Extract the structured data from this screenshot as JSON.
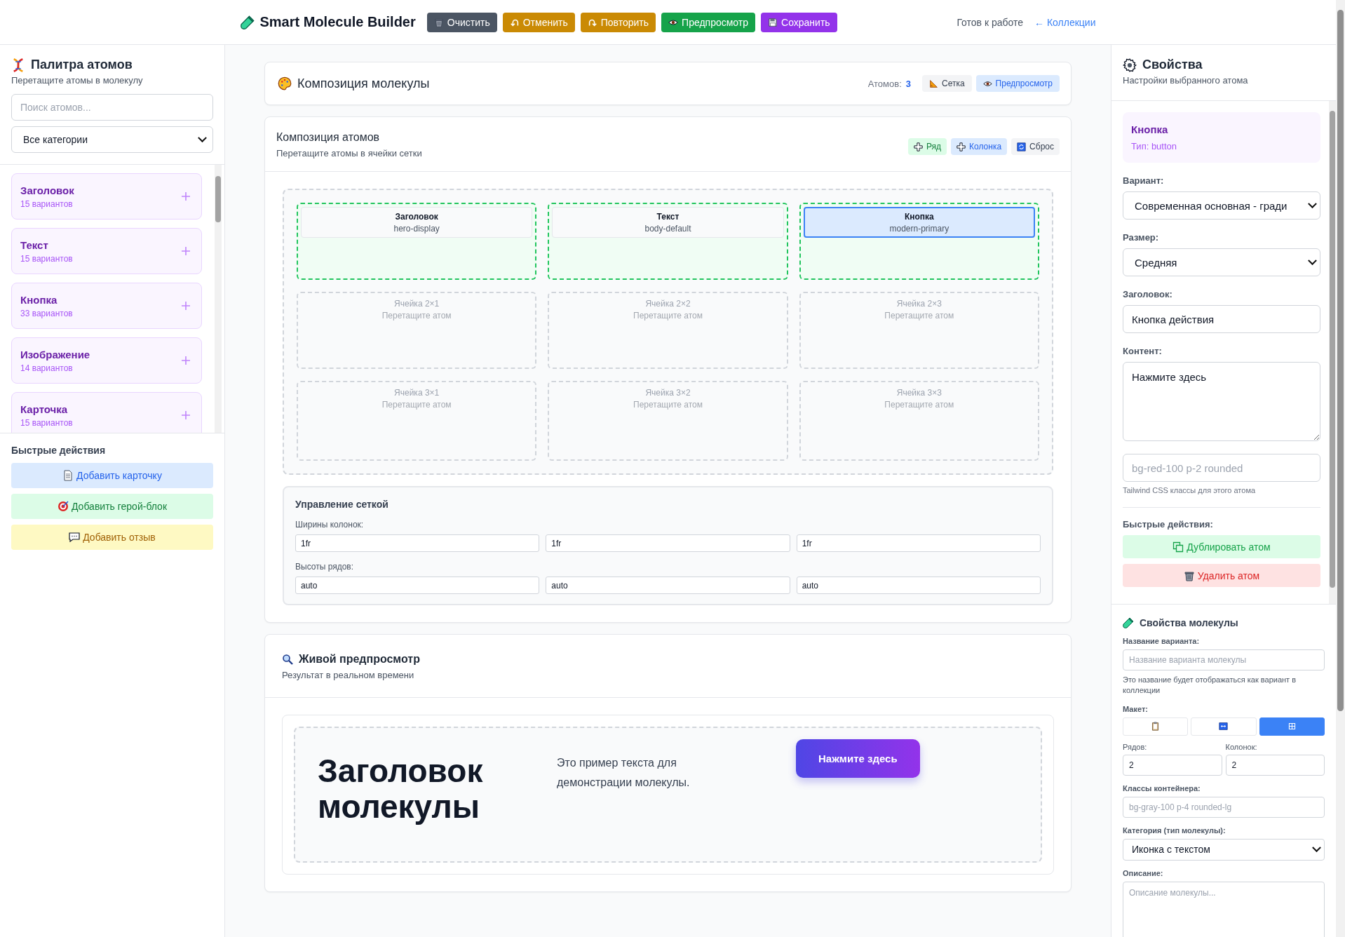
{
  "header": {
    "title": "Smart Molecule Builder",
    "buttons": [
      {
        "label": "Очистить",
        "color": "#4b5563"
      },
      {
        "label": "Отменить",
        "color": "#ca8a04"
      },
      {
        "label": "Повторить",
        "color": "#ca8a04"
      },
      {
        "label": "Предпросмотр",
        "color": "#16a34a"
      },
      {
        "label": "Сохранить",
        "color": "#9333ea"
      }
    ],
    "status": "Готов к работе",
    "back_link": "← Коллекции"
  },
  "palette": {
    "title": "Палитра атомов",
    "subtitle": "Перетащите атомы в молекулу",
    "search": {
      "placeholder": "Поиск атомов..."
    },
    "category": {
      "value": "Все категории"
    },
    "atoms": [
      {
        "name": "Заголовок",
        "count": "15 вариантов"
      },
      {
        "name": "Текст",
        "count": "15 вариантов"
      },
      {
        "name": "Кнопка",
        "count": "33 вариантов"
      },
      {
        "name": "Изображение",
        "count": "14 вариантов"
      },
      {
        "name": "Карточка",
        "count": "15 вариантов"
      }
    ],
    "quick_title": "Быстрые действия",
    "quick_actions": [
      {
        "label": "Добавить карточку",
        "color": "#dbeafe"
      },
      {
        "label": "Добавить герой-блок",
        "color": "#dcfce7"
      },
      {
        "label": "Добавить отзыв",
        "color": "#fef9c3"
      }
    ]
  },
  "composition": {
    "title": "Композиция молекулы",
    "atoms_label": "Атомов:",
    "atoms_count": "3",
    "view_buttons": [
      {
        "label": "Сетка",
        "selected": false
      },
      {
        "label": "Предпросмотр",
        "selected": true
      }
    ]
  },
  "grid": {
    "title": "Композиция атомов",
    "subtitle": "Перетащите атомы в ячейки сетки",
    "actions": [
      {
        "label": "Ряд",
        "color": "#dcfce7"
      },
      {
        "label": "Колонка",
        "color": "#dbeafe"
      },
      {
        "label": "Сброс",
        "color": "#f3f4f6"
      }
    ],
    "cells": [
      {
        "kind": "filled",
        "name": "Заголовок",
        "variant": "hero-display",
        "selected": false
      },
      {
        "kind": "filled",
        "name": "Текст",
        "variant": "body-default",
        "selected": false
      },
      {
        "kind": "filled",
        "name": "Кнопка",
        "variant": "modern-primary",
        "selected": true
      },
      {
        "kind": "empty",
        "name": "Ячейка 2×1",
        "hint": "Перетащите атом"
      },
      {
        "kind": "empty",
        "name": "Ячейка 2×2",
        "hint": "Перетащите атом"
      },
      {
        "kind": "empty",
        "name": "Ячейка 2×3",
        "hint": "Перетащите атом"
      },
      {
        "kind": "empty",
        "name": "Ячейка 3×1",
        "hint": "Перетащите атом"
      },
      {
        "kind": "empty",
        "name": "Ячейка 3×2",
        "hint": "Перетащите атом"
      },
      {
        "kind": "empty",
        "name": "Ячейка 3×3",
        "hint": "Перетащите атом"
      }
    ],
    "controls": {
      "title": "Управление сеткой",
      "widths_label": "Ширины колонок:",
      "widths": [
        "1fr",
        "1fr",
        "1fr"
      ],
      "heights_label": "Высоты рядов:",
      "heights": [
        "auto",
        "auto",
        "auto"
      ]
    }
  },
  "preview": {
    "title": "Живой предпросмотр",
    "subtitle": "Результат в реальном времени",
    "heading": "Заголовок молекулы",
    "text": "Это пример текста для демонстрации молекулы.",
    "button": "Нажмите здесь"
  },
  "properties": {
    "title": "Свойства",
    "subtitle": "Настройки выбранного атома",
    "atom": {
      "name": "Кнопка",
      "type": "Тип: button"
    },
    "fields": [
      {
        "kind": "select",
        "label": "Вариант:",
        "value": "Современная основная - гради"
      },
      {
        "kind": "select",
        "label": "Размер:",
        "value": "Средняя"
      },
      {
        "kind": "input",
        "label": "Заголовок:",
        "value": "Кнопка действия"
      },
      {
        "kind": "textarea",
        "label": "Контент:",
        "value": "Нажмите здесь"
      },
      {
        "kind": "input",
        "placeholder": "bg-red-100 p-2 rounded",
        "help": "Tailwind CSS классы для этого атома"
      }
    ],
    "quick_title": "Быстрые действия:",
    "actions": [
      {
        "label": "Дублировать атом",
        "kind": "duplicate"
      },
      {
        "label": "Удалить атом",
        "kind": "delete"
      }
    ]
  },
  "molecule": {
    "title": "Свойства молекулы",
    "name_label": "Название варианта:",
    "name_placeholder": "Название варианта молекулы",
    "name_help": "Это название будет отображаться как вариант в коллекции",
    "layout_label": "Макет:",
    "layouts": [
      {
        "selected": false
      },
      {
        "selected": false
      },
      {
        "selected": true
      }
    ],
    "rows_label": "Рядов:",
    "rows": "2",
    "cols_label": "Колонок:",
    "cols": "2",
    "classes_label": "Классы контейнера:",
    "classes_placeholder": "bg-gray-100 p-4 rounded-lg",
    "category_label": "Категория (тип молекулы):",
    "category": "Иконка с текстом",
    "description_label": "Описание:",
    "description_placeholder": "Описание молекулы..."
  }
}
